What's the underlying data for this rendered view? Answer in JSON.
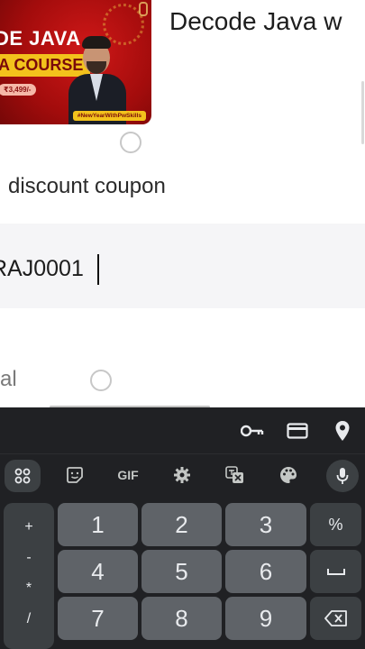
{
  "course": {
    "title": "Decode Java w",
    "thumbnail": {
      "line1": "DE JAVA",
      "line2": "A COURSE",
      "price": "₹3,499/-",
      "hashtag": "#NewYearWithPwSkills"
    }
  },
  "coupon": {
    "label": "discount coupon",
    "value": "RAJ0001"
  },
  "total": {
    "label": "al"
  },
  "keyboard": {
    "toolbar": {
      "gif_label": "GIF"
    },
    "symbols": [
      "+",
      "-",
      "*",
      "/"
    ],
    "keys": {
      "k1": "1",
      "k2": "2",
      "k3": "3",
      "pct": "%",
      "k4": "4",
      "k5": "5",
      "k6": "6",
      "k7": "7",
      "k8": "8",
      "k9": "9"
    }
  },
  "colors": {
    "keyboard_bg": "#202124",
    "key_bg": "#5f6368",
    "fn_key_bg": "#3c4043",
    "thumbnail_red": "#c41414",
    "thumbnail_yellow": "#f3c21c"
  }
}
